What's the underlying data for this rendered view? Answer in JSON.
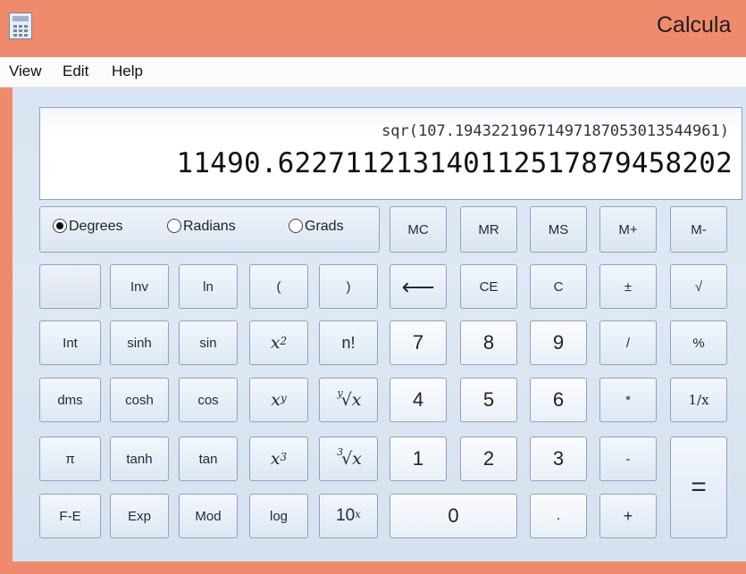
{
  "window": {
    "title": "Calcula"
  },
  "menu": [
    "View",
    "Edit",
    "Help"
  ],
  "display": {
    "expression": "sqr(107.19432219671497187053013544961)",
    "result": "11490.62271121314011251787945820 2"
  },
  "angle_modes": {
    "degrees": "Degrees",
    "radians": "Radians",
    "grads": "Grads",
    "selected": "Degrees"
  },
  "buttons": {
    "mc": "MC",
    "mr": "MR",
    "ms": "MS",
    "m_plus": "M+",
    "m_minus": "M-",
    "inv": "Inv",
    "ln": "ln",
    "lparen": "(",
    "rparen": ")",
    "backspace": "⟵",
    "ce": "CE",
    "c": "C",
    "plusminus": "±",
    "sqrt": "√",
    "int": "Int",
    "sinh": "sinh",
    "sin": "sin",
    "x_squared": "x",
    "x_squared_exp": "2",
    "n_fact": "n!",
    "seven": "7",
    "eight": "8",
    "nine": "9",
    "divide": "/",
    "percent": "%",
    "dms": "dms",
    "cosh": "cosh",
    "cos": "cos",
    "x_pow_y": "x",
    "x_pow_y_exp": "y",
    "yroot_index": "y",
    "yroot": "√x",
    "four": "4",
    "five": "5",
    "six": "6",
    "multiply": "*",
    "reciprocal": "1/x",
    "pi": "π",
    "tanh": "tanh",
    "tan": "tan",
    "x_cubed": "x",
    "x_cubed_exp": "3",
    "cuberoot_index": "3",
    "cuberoot": "√x",
    "one": "1",
    "two": "2",
    "three": "3",
    "minus": "-",
    "equals": "=",
    "fe": "F-E",
    "exp": "Exp",
    "mod": "Mod",
    "log": "log",
    "ten_pow_x": "10",
    "ten_pow_x_exp": "x",
    "zero": "0",
    "decimal": ".",
    "plus": "+"
  }
}
